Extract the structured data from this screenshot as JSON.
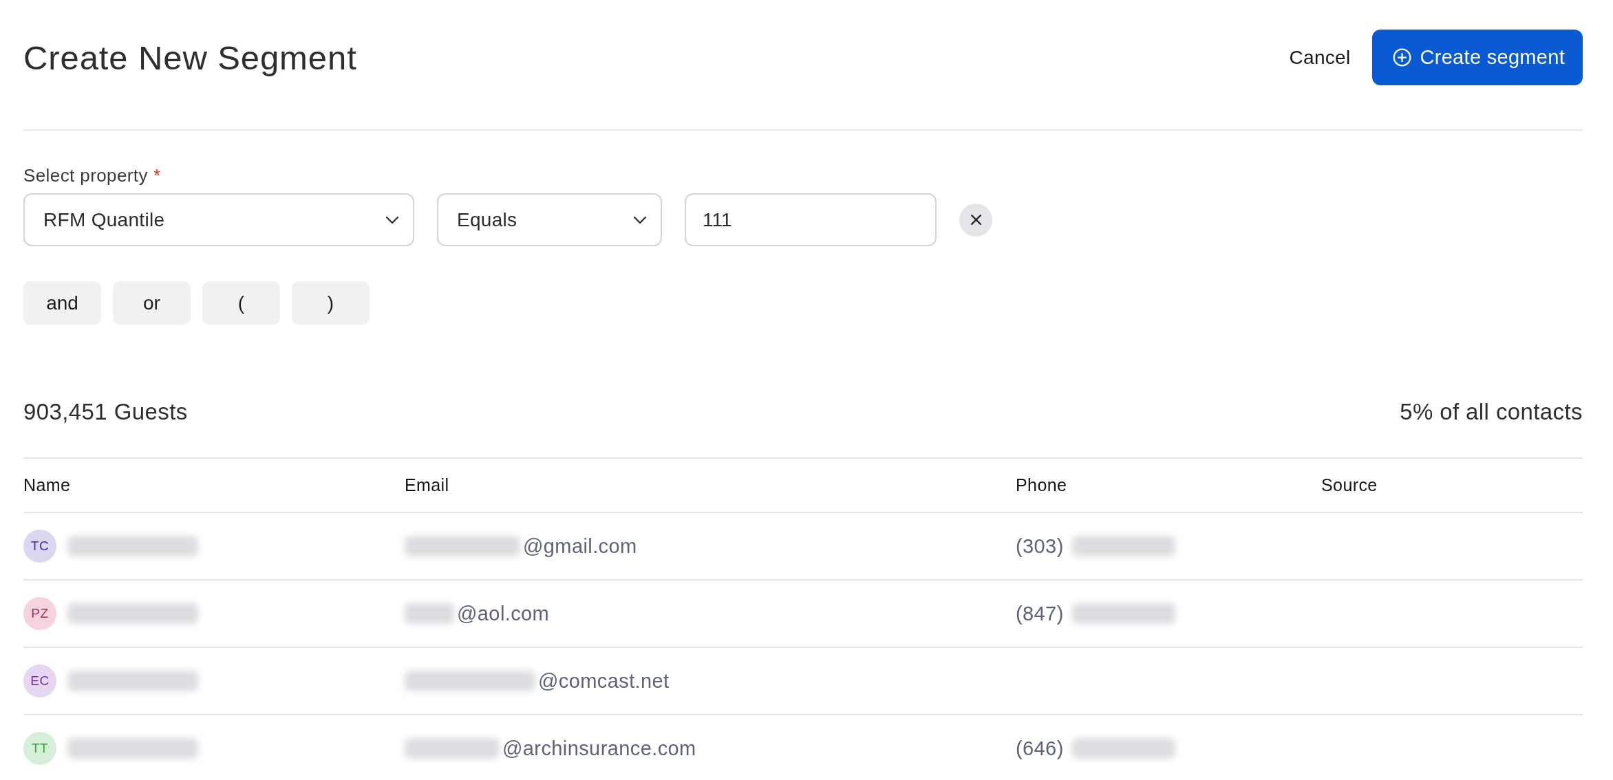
{
  "header": {
    "title": "Create New Segment",
    "cancel_label": "Cancel",
    "create_label": "Create segment"
  },
  "filter": {
    "label": "Select property",
    "required_mark": "*",
    "property": {
      "value": "RFM Quantile"
    },
    "operator": {
      "value": "Equals"
    },
    "value_field": {
      "value": "111"
    }
  },
  "operators": [
    "and",
    "or",
    "(",
    ")"
  ],
  "summary": {
    "count": "903,451 Guests",
    "share": "5% of all contacts"
  },
  "table": {
    "columns": [
      "Name",
      "Email",
      "Phone",
      "Source"
    ],
    "rows": [
      {
        "initials": "TC",
        "color": "#dcd7f1",
        "email": "@gmail.com",
        "phone": "(303)"
      },
      {
        "initials": "PZ",
        "color": "#f6d3df",
        "email": "@aol.com",
        "phone": "(847)"
      },
      {
        "initials": "EC",
        "color": "#e7d6f1",
        "email": "@comcast.net"
      },
      {
        "initials": "TT",
        "color": "#d6efd8",
        "email": "@archinsurance.com",
        "phone": "(646)"
      }
    ]
  }
}
